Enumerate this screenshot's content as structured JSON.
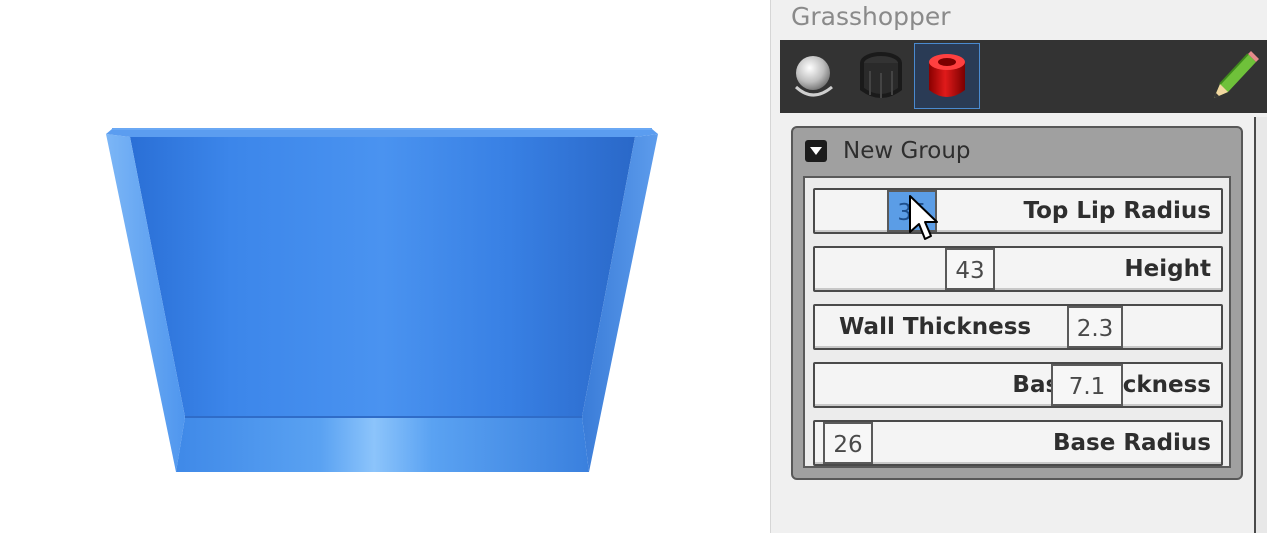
{
  "panel": {
    "title": "Grasshopper",
    "toolbar": {
      "buttons": [
        {
          "icon": "sphere-preview-icon",
          "selected": false
        },
        {
          "icon": "wireframe-preview-icon",
          "selected": false
        },
        {
          "icon": "shaded-preview-icon",
          "selected": true
        }
      ],
      "right_icon": "pencil-icon"
    }
  },
  "group": {
    "title": "New Group",
    "sliders": [
      {
        "label": "Top Lip Radius",
        "value": "35"
      },
      {
        "label": "Height",
        "value": "43"
      },
      {
        "label": "Wall Thickness",
        "value": "2.3"
      },
      {
        "label": "Base Thickness",
        "value": "7.1"
      },
      {
        "label": "Base Radius",
        "value": "26"
      }
    ]
  },
  "colors": {
    "model": "#3a82e6",
    "toolbar": "#333333",
    "group": "#a0a0a0",
    "slider_active": "#5b9de6"
  }
}
